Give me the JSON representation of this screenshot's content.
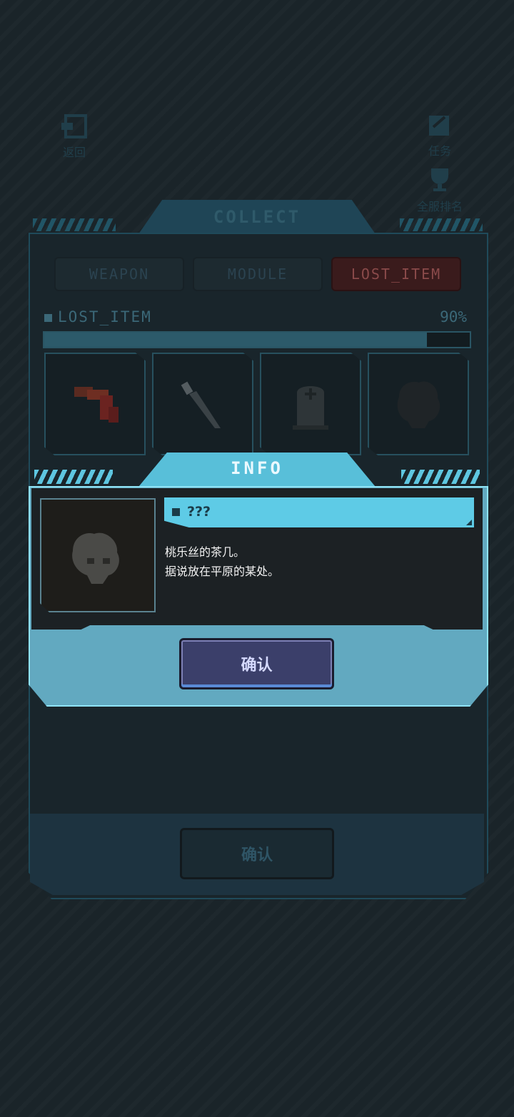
{
  "top_nav": {
    "back_label": "返回",
    "tasks_label": "任务",
    "ranking_label": "全服排名"
  },
  "collect": {
    "title": "COLLECT",
    "tabs": [
      {
        "label": "WEAPON",
        "active": false
      },
      {
        "label": "MODULE",
        "active": false
      },
      {
        "label": "LOST_ITEM",
        "active": true
      }
    ],
    "section_label": "LOST_ITEM",
    "progress_text": "90%",
    "progress_value": 0.9,
    "items": [
      {
        "icon": "red-ribbon-icon"
      },
      {
        "icon": "knife-icon"
      },
      {
        "icon": "tombstone-icon"
      },
      {
        "icon": "unknown-item-silhouette-icon"
      }
    ],
    "confirm_label": "确认"
  },
  "info_modal": {
    "title": "INFO",
    "item_name": "???",
    "description_line1": "桃乐丝的茶几。",
    "description_line2": "据说放在平原的某处。",
    "confirm_label": "确认"
  },
  "colors": {
    "modal_accent": "#5ecbe6",
    "background": "#1a2429",
    "active_tab": "#3a1b1c",
    "confirm_button": "#3b3f6a"
  }
}
